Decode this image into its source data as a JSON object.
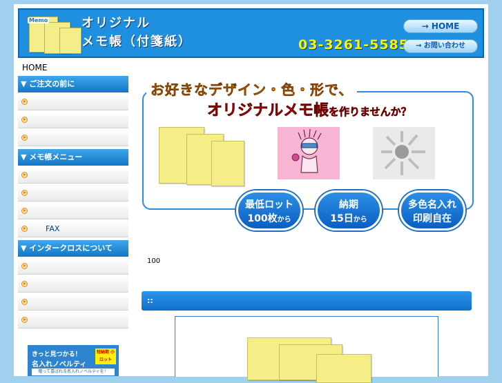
{
  "header": {
    "logo_text": "Memo",
    "title_line1": "オリジナル",
    "title_line2": "メモ帳（付箋紙）",
    "phone": "03-3261-5585",
    "home_button": "→ HOME",
    "contact_button": "→ お問い合わせ"
  },
  "sidebar": {
    "home_link": "HOME",
    "sections": [
      {
        "title": "▼ ご注文の前に",
        "items": [
          "",
          "",
          ""
        ]
      },
      {
        "title": "▼ メモ帳メニュー",
        "items": [
          "",
          "",
          "",
          "FAX"
        ]
      },
      {
        "title": "▼ インタークロスについて",
        "items": [
          "",
          "",
          "",
          ""
        ]
      }
    ],
    "banner": {
      "line1": "きっと見つかる！",
      "line2": "名入れノベルティ",
      "tag": "短納期 小ロット",
      "line3": "贈って喜ばれる名入れノベルティを！"
    }
  },
  "hero": {
    "line1": "お好きなデザイン・色・形で、",
    "line2_main": "オリジナルメモ帳",
    "line2_suffix": "を作りませんか？",
    "features": [
      {
        "top": "最低ロット",
        "bottom": "100枚",
        "suffix": "から"
      },
      {
        "top": "納期",
        "bottom": "15日",
        "suffix": "から"
      },
      {
        "top": "多色名入れ",
        "bottom": "印刷自在",
        "suffix": ""
      }
    ]
  },
  "content": {
    "body_text": "100",
    "section_bar": "::"
  }
}
